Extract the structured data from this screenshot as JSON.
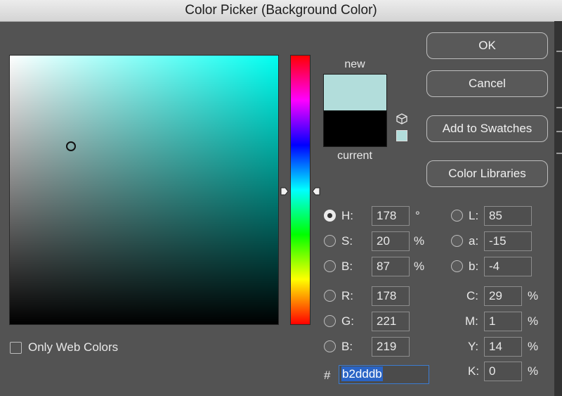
{
  "window": {
    "title": "Color Picker (Background Color)"
  },
  "preview": {
    "new_label": "new",
    "current_label": "current",
    "new_color": "#b2dddb",
    "current_color": "#000000"
  },
  "field": {
    "base_hue_color": "#00fff1"
  },
  "buttons": {
    "ok": "OK",
    "cancel": "Cancel",
    "add_to_swatches": "Add to Swatches",
    "color_libraries": "Color Libraries"
  },
  "hsb": [
    {
      "label": "H:",
      "value": "178",
      "unit": "°",
      "selected": true
    },
    {
      "label": "S:",
      "value": "20",
      "unit": "%",
      "selected": false
    },
    {
      "label": "B:",
      "value": "87",
      "unit": "%",
      "selected": false
    }
  ],
  "rgb": [
    {
      "label": "R:",
      "value": "178"
    },
    {
      "label": "G:",
      "value": "221"
    },
    {
      "label": "B:",
      "value": "219"
    }
  ],
  "lab": [
    {
      "label": "L:",
      "value": "85"
    },
    {
      "label": "a:",
      "value": "-15"
    },
    {
      "label": "b:",
      "value": "-4"
    }
  ],
  "cmyk": [
    {
      "label": "C:",
      "value": "29",
      "unit": "%"
    },
    {
      "label": "M:",
      "value": "1",
      "unit": "%"
    },
    {
      "label": "Y:",
      "value": "14",
      "unit": "%"
    },
    {
      "label": "K:",
      "value": "0",
      "unit": "%"
    }
  ],
  "hex": {
    "prefix": "#",
    "value": "b2dddb"
  },
  "web_colors": {
    "label": "Only Web Colors",
    "checked": false
  },
  "icons": {
    "gamut": "cube-icon",
    "websafe": "websafe-swatch-icon"
  }
}
